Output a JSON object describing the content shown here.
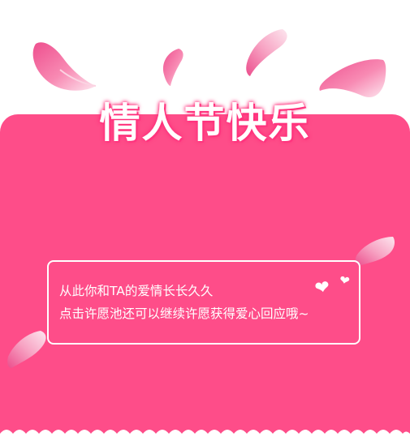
{
  "banner": {
    "title": "情人节快乐"
  },
  "message": {
    "line1": "从此你和TA的爱情长长久久",
    "line2": "点击许愿池还可以继续许愿获得爱心回应哦~"
  },
  "icons": {
    "heart": "❤",
    "petal": "rose-petal-icon"
  },
  "colors": {
    "card_background": "#fe4d89",
    "text": "#ffffff",
    "petal_light": "#fbd3e2",
    "petal_dark": "#ee4f8e"
  }
}
